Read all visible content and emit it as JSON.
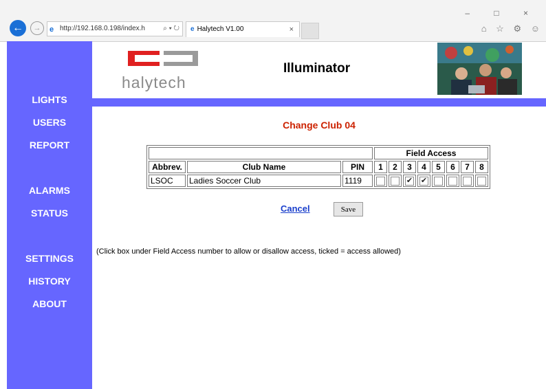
{
  "browser": {
    "url": "http://192.168.0.198/index.h",
    "address_tools": "⌕ ▾ ↻",
    "tab_title": "Halytech V1.00",
    "tab_close": "×",
    "window_controls": "– □ ×",
    "toolbar_icons": "⌂ ☆ ⚙ ☺"
  },
  "sidebar": {
    "items": [
      {
        "label": "LIGHTS"
      },
      {
        "label": "USERS"
      },
      {
        "label": "REPORT"
      },
      {
        "label": "ALARMS"
      },
      {
        "label": "STATUS"
      },
      {
        "label": "SETTINGS"
      },
      {
        "label": "HISTORY"
      },
      {
        "label": "ABOUT"
      }
    ],
    "color": "#6666ff"
  },
  "header": {
    "logo_text": "halytech",
    "title": "Illuminator"
  },
  "page": {
    "title": "Change Club 04"
  },
  "table": {
    "group_header": "Field Access",
    "columns": {
      "abbrev": "Abbrev.",
      "club_name": "Club Name",
      "pin": "PIN"
    },
    "field_numbers": [
      "1",
      "2",
      "3",
      "4",
      "5",
      "6",
      "7",
      "8"
    ],
    "row": {
      "abbrev": "LSOC",
      "club_name": "Ladies Soccer Club",
      "pin": "1119",
      "access": [
        false,
        false,
        true,
        true,
        false,
        false,
        false,
        false
      ]
    }
  },
  "actions": {
    "cancel_label": "Cancel",
    "save_label": "Save"
  },
  "help_text": "(Click box under Field Access number to allow or disallow access, ticked = access allowed)",
  "colors": {
    "title_red": "#cc2200",
    "link_blue": "#1a3fcc",
    "logo_red": "#e02020"
  }
}
